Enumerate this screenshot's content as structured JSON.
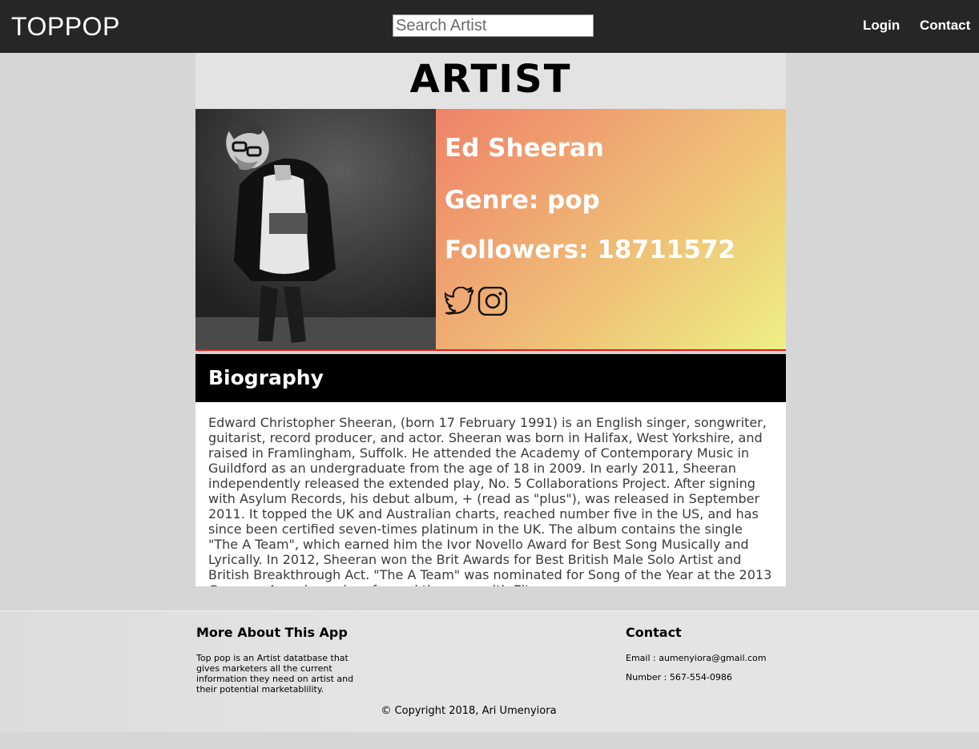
{
  "nav": {
    "brand": "TOPPOP",
    "search_placeholder": "Search Artist",
    "login": "Login",
    "contact": "Contact"
  },
  "page": {
    "title": "ARTIST"
  },
  "artist": {
    "name": "Ed Sheeran",
    "genre": "Genre: pop",
    "followers": "Followers: 18711572",
    "social_icons": [
      "twitter-icon",
      "instagram-icon"
    ]
  },
  "biography": {
    "heading": "Biography",
    "text": "Edward Christopher Sheeran, (born 17 February 1991) is an English singer, songwriter, guitarist, record producer, and actor. Sheeran was born in Halifax, West Yorkshire, and raised in Framlingham, Suffolk. He attended the Academy of Contemporary Music in Guildford as an undergraduate from the age of 18 in 2009. In early 2011, Sheeran independently released the extended play, No. 5 Collaborations Project. After signing with Asylum Records, his debut album, + (read as \"plus\"), was released in September 2011. It topped the UK and Australian charts, reached number five in the US, and has since been certified seven-times platinum in the UK. The album contains the single \"The A Team\", which earned him the Ivor Novello Award for Best Song Musically and Lyrically. In 2012, Sheeran won the Brit Awards for Best British Male Solo Artist and British Breakthrough Act. \"The A Team\" was nominated for Song of the Year at the 2013 Grammy Awards, and performed the song with Elton"
  },
  "footer": {
    "about_heading": "More About This App",
    "about_text": "Top pop is an Artist datatbase that gives marketers all the current information they need on artist and their potential marketablility.",
    "contact_heading": "Contact",
    "email": "Email : aumenyiora@gmail.com",
    "number": "Number : 567-554-0986",
    "copyright": "© Copyright 2018, Ari Umenyiora"
  },
  "colors": {
    "navbar": "#262626",
    "info_gradient_start": "#ef8268",
    "info_gradient_end": "#eeef84",
    "divider": "#e41e1e"
  }
}
